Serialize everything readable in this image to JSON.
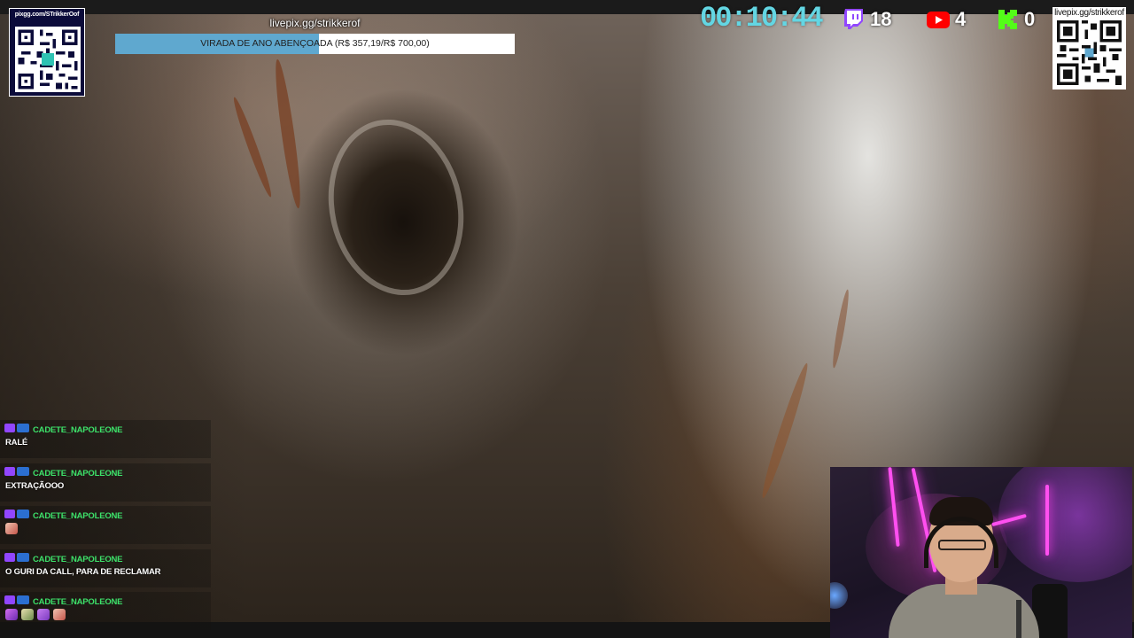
{
  "overlay": {
    "qr_left": {
      "url": "pixgg.com/STrikkerOof"
    },
    "qr_right": {
      "url": "livepix.gg/strikkerof"
    },
    "goal": {
      "url": "livepix.gg/strikkerof",
      "label": "VIRADA DE ANO ABENÇOADA (R$ 357,19/R$ 700,00)",
      "progress_fraction": 0.51,
      "fill_color": "#5fa8cf"
    },
    "timer": "00:10:44",
    "counters": {
      "twitch": {
        "icon": "twitch-icon",
        "value": "18",
        "color": "#9146ff"
      },
      "youtube": {
        "icon": "youtube-icon",
        "value": "4",
        "color": "#ff0000"
      },
      "kick": {
        "icon": "kick-icon",
        "value": "0",
        "color": "#53fc18"
      }
    }
  },
  "chat": {
    "messages": [
      {
        "user": "CADETE_NAPOLEONE",
        "text": "RALÉ"
      },
      {
        "user": "CADETE_NAPOLEONE",
        "text": "EXTRAÇÃOOO"
      },
      {
        "user": "CADETE_NAPOLEONE",
        "text": "",
        "emotes": [
          "emote"
        ]
      },
      {
        "user": "CADETE_NAPOLEONE",
        "text": "O GURI DA CALL, PARA DE RECLAMAR"
      },
      {
        "user": "CADETE_NAPOLEONE",
        "text": "",
        "emotes": [
          "emote",
          "emote",
          "emote",
          "emote"
        ]
      }
    ],
    "username_color": "#3de26a"
  },
  "webcam": {
    "accent": "#ff4ff0"
  }
}
